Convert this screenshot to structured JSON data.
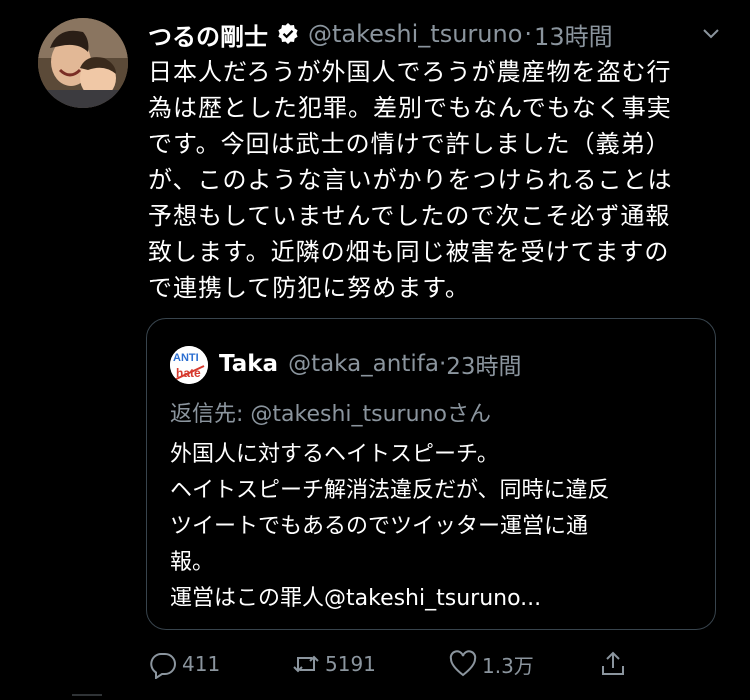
{
  "tweet": {
    "author_name": "つるの剛士",
    "handle": "@takeshi_tsuruno",
    "separator": "·",
    "time": "13時間",
    "text_lines": [
      "日本人だろうが外国人でろうが農産物を盗む行",
      "為は歴とした犯罪。差別でもなんでもなく事実",
      "です。今回は武士の情けで許しました（義弟）",
      "が、このような言いがかりをつけられることは",
      "予想もしていませんでしたので次こそ必ず通報",
      "致します。近隣の畑も同じ被害を受けてますの",
      "で連携して防犯に努めます。"
    ]
  },
  "quote": {
    "avatar_text": "ANTI hate",
    "author_name": "Taka",
    "handle": "@taka_antifa",
    "separator": "·",
    "time": "23時間",
    "reply_to": "返信先: @takeshi_tsurunoさん",
    "body_lines": [
      "外国人に対するヘイトスピーチ。",
      "ヘイトスピーチ解消法違反だが、同時に違反",
      "ツイートでもあるのでツイッター運営に通",
      "報。",
      "運営はこの罪人@takeshi_tsuruno..."
    ]
  },
  "actions": {
    "reply_count": "411",
    "retweet_count": "5191",
    "like_count": "1.3万",
    "icons": [
      "reply-icon",
      "retweet-icon",
      "like-icon",
      "share-icon"
    ]
  },
  "colors": {
    "background": "#000000",
    "text": "#ffffff",
    "secondary": "#8b959e",
    "border": "#38444d"
  }
}
